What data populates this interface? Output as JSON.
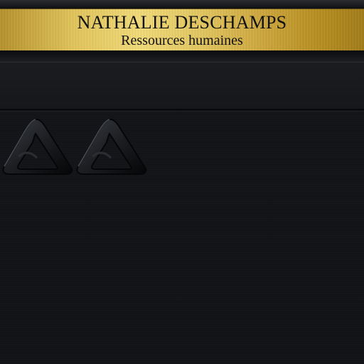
{
  "nameplate": {
    "name": "NATHALIE DESCHAMPS",
    "role": "Ressources humaines"
  },
  "emblems": [
    {
      "icon": "triangle-knot-icon"
    },
    {
      "icon": "triangle-knot-icon"
    }
  ],
  "colors": {
    "gold": "#e2c55c",
    "panel": "#121418",
    "text": "#111111"
  }
}
